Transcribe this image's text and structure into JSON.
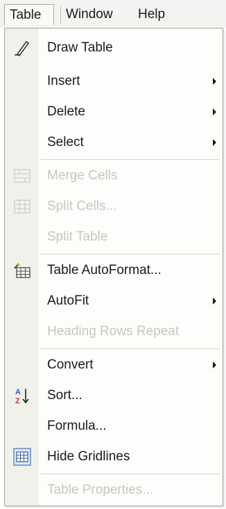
{
  "menubar": {
    "table_label": "Table",
    "window_label": "Window",
    "help_label": "Help"
  },
  "menu": {
    "items": [
      {
        "label": "Draw Table",
        "icon": "pencil-icon",
        "enabled": true,
        "submenu": false
      },
      {
        "label": "Insert",
        "icon": null,
        "enabled": true,
        "submenu": true
      },
      {
        "label": "Delete",
        "icon": null,
        "enabled": true,
        "submenu": true
      },
      {
        "label": "Select",
        "icon": null,
        "enabled": true,
        "submenu": true
      },
      {
        "label": "Merge Cells",
        "icon": "merge-cells-icon",
        "enabled": false,
        "submenu": false
      },
      {
        "label": "Split Cells...",
        "icon": "split-cells-icon",
        "enabled": false,
        "submenu": false
      },
      {
        "label": "Split Table",
        "icon": null,
        "enabled": false,
        "submenu": false
      },
      {
        "label": "Table AutoFormat...",
        "icon": "table-autoformat-icon",
        "enabled": true,
        "submenu": false
      },
      {
        "label": "AutoFit",
        "icon": null,
        "enabled": true,
        "submenu": true
      },
      {
        "label": "Heading Rows Repeat",
        "icon": null,
        "enabled": false,
        "submenu": false
      },
      {
        "label": "Convert",
        "icon": null,
        "enabled": true,
        "submenu": true
      },
      {
        "label": "Sort...",
        "icon": "sort-az-icon",
        "enabled": true,
        "submenu": false
      },
      {
        "label": "Formula...",
        "icon": null,
        "enabled": true,
        "submenu": false
      },
      {
        "label": "Hide Gridlines",
        "icon": "gridlines-icon",
        "enabled": true,
        "submenu": false
      },
      {
        "label": "Table Properties...",
        "icon": null,
        "enabled": false,
        "submenu": false
      }
    ]
  }
}
